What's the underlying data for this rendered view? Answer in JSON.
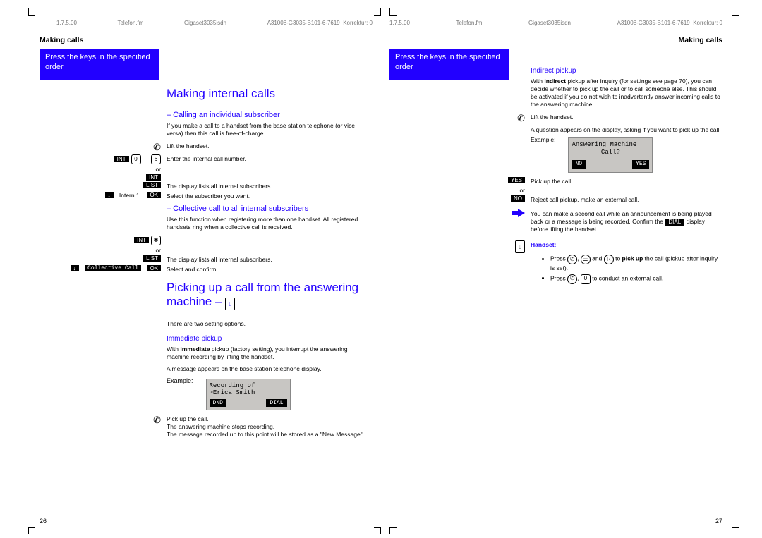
{
  "header_left": {
    "date": "1.7.5.00",
    "fm": "Telefon.fm",
    "model": "Gigaset3035isdn",
    "doc": "A31008-G3035-B101-6-7619",
    "corr": "Korrektur: 0"
  },
  "header_right": {
    "date": "1.7.5.00",
    "fm": "Telefon.fm",
    "model": "Gigaset3035isdn",
    "doc": "A31008-G3035-B101-6-7619",
    "corr": "Korrektur: 0"
  },
  "running_head": "Making calls",
  "ribbon": "Press the keys in the specified order",
  "page_left": {
    "h1": "Making internal calls",
    "sec1": {
      "title": "– Calling an individual subscriber",
      "intro": "If you make a call to a handset from the base station telephone (or vice versa) then this call is free-of-charge.",
      "steps": [
        {
          "icons": "",
          "text": "Lift the handset."
        },
        {
          "icons": "INT 0 … 6",
          "text": "Enter the internal call number."
        },
        {
          "icons": "or",
          "text": ""
        },
        {
          "icons": "INT",
          "text": ""
        },
        {
          "icons": "LIST",
          "text": "The display lists all internal subscribers."
        },
        {
          "icons": "↓ Intern 1   OK",
          "text": "Select the subscriber you want."
        }
      ]
    },
    "sec2": {
      "title": "– Collective call to all internal subscribers",
      "intro": "Use this function when registering more than one handset. All registered handsets ring when a collective call is received.",
      "steps": [
        {
          "icons": "INT ✱",
          "text": ""
        },
        {
          "icons": "or",
          "text": ""
        },
        {
          "icons": "LIST",
          "text": "The display lists all internal subscribers."
        },
        {
          "icons": "↓ Collective Call  OK",
          "text": "Select and confirm."
        }
      ]
    },
    "h1b": "Picking up a call from the answering machine –",
    "twoopt": "There are two setting options.",
    "sec3": {
      "title": "Immediate pickup",
      "p1_a": "With ",
      "p1_b": "immediate",
      "p1_c": " pickup (factory setting), you interrupt the answering machine recording by lifting the handset.",
      "p2": "A message appears on the base station telephone display.",
      "example_label": "Example:",
      "lcd_l1": "Recording of",
      "lcd_l2": ">Erica Smith",
      "sk_l": "DND",
      "sk_r": "DIAL",
      "p3": "Pick up the call.",
      "p4": "The answering machine stops recording.",
      "p5": "The message recorded up to this point will be stored as a \"New Message\"."
    },
    "pn": "26"
  },
  "page_right": {
    "sec1": {
      "title": "Indirect pickup",
      "p1_a": "With ",
      "p1_b": "indirect",
      "p1_c": " pickup after inquiry (for settings see page 70), you can decide whether to pick up the call or to call someone else. This should be activated if you do not wish to inadvertently answer incoming calls to the answering machine.",
      "s1": "Lift the handset.",
      "s2": "A question appears on the display, asking if you want to pick up the call.",
      "example_label": "Example:",
      "lcd_l1": "Answering Machine",
      "lcd_l2": "Call?",
      "sk_l": "NO",
      "sk_r": "YES",
      "yes": "YES",
      "or": "or",
      "no": "NO",
      "s_yes": "Pick up the call.",
      "s_no": "Reject call pickup, make an external call.",
      "note": "You can make a second call while an announcement is being played back or a message is being recorded. Confirm the DIAL display before lifting the handset.",
      "dial_tag": "DIAL",
      "handset_label": "Handset:",
      "b1_a": "Press ",
      "b1_b": " and ",
      "b1_c": " to ",
      "b1_d": "pick up",
      "b1_e": " the call (pickup after inquiry is set).",
      "b2_a": "Press ",
      "b2_b": " to conduct an external call."
    },
    "pn": "27"
  }
}
